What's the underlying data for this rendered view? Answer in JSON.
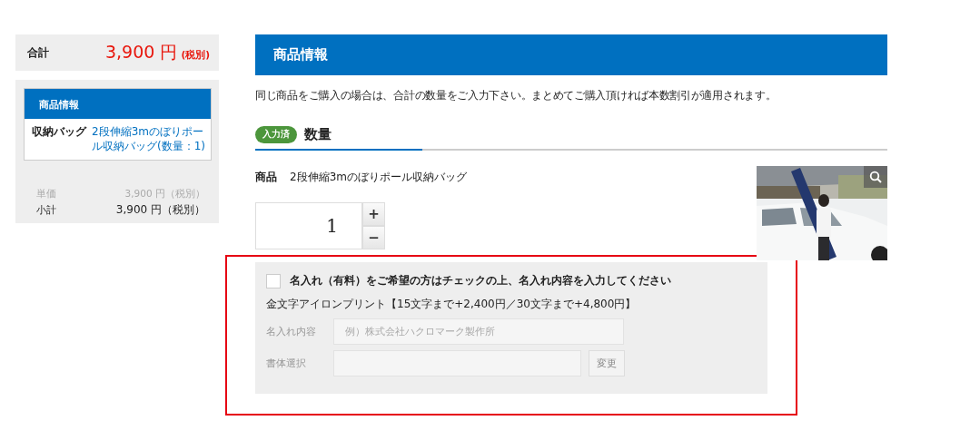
{
  "summary": {
    "label": "合計",
    "amount": "3,900 円",
    "tax_note": "(税別)"
  },
  "info_panel": {
    "title": "商品情報",
    "rows": [
      {
        "label": "収納バッグ",
        "value": "2段伸縮3mのぼりポール収納バッグ(数量：1)"
      }
    ],
    "unit_price": {
      "label": "単価",
      "value": "3,900 円（税別）"
    },
    "subtotal": {
      "label": "小計",
      "value": "3,900 円（税別）"
    }
  },
  "main": {
    "header": "商品情報",
    "note": "同じ商品をご購入の場合は、合計の数量をご入力下さい。まとめてご購入頂ければ本数割引が適用されます。",
    "step": {
      "badge": "入力済",
      "title": "数量"
    },
    "product": {
      "label": "商品",
      "name": "2段伸縮3mのぼりポール収納バッグ"
    },
    "quantity": {
      "value": "1",
      "plus": "+",
      "minus": "−"
    },
    "engraving": {
      "checked": false,
      "label": "名入れ（有料）をご希望の方はチェックの上、名入れ内容を入力してください",
      "pricing": "金文字アイロンプリント【15文字まで+2,400円／30文字まで+4,800円】",
      "text_field": {
        "label": "名入れ内容",
        "placeholder": "例）株式会社ハクロマーク製作所"
      },
      "font_field": {
        "label": "書体選択",
        "button": "変更"
      }
    }
  }
}
